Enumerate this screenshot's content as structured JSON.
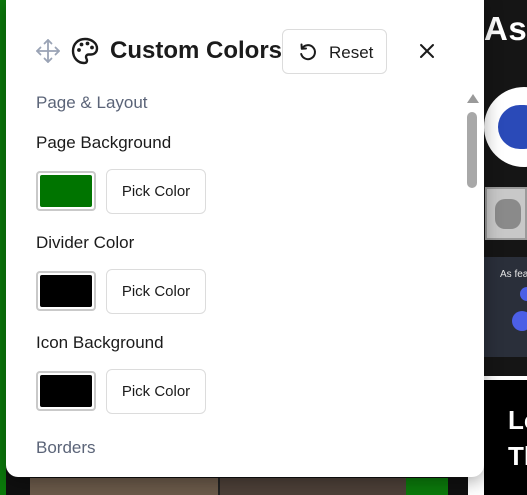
{
  "backdrop": {
    "headline": "As",
    "card_text": "As fea",
    "black_card_text": "Lo\nTh"
  },
  "panel": {
    "title": "Custom Colors",
    "reset_label": "Reset",
    "icons": {
      "move": "move-icon",
      "palette": "palette-icon",
      "reset": "reset-icon",
      "close": "close-icon"
    },
    "sections": [
      {
        "heading": "Page & Layout"
      },
      {
        "heading": "Borders"
      }
    ],
    "fields": [
      {
        "label": "Page Background",
        "color": "#007400",
        "button": "Pick Color"
      },
      {
        "label": "Divider Color",
        "color": "#000000",
        "button": "Pick Color"
      },
      {
        "label": "Icon Background",
        "color": "#000000",
        "button": "Pick Color"
      }
    ]
  },
  "colors": {
    "panel_bg": "#ffffff",
    "section_heading": "#5b6478",
    "text": "#1b1b1b",
    "button_border": "#dcdcdc",
    "page_green": "#0b7a0b"
  }
}
